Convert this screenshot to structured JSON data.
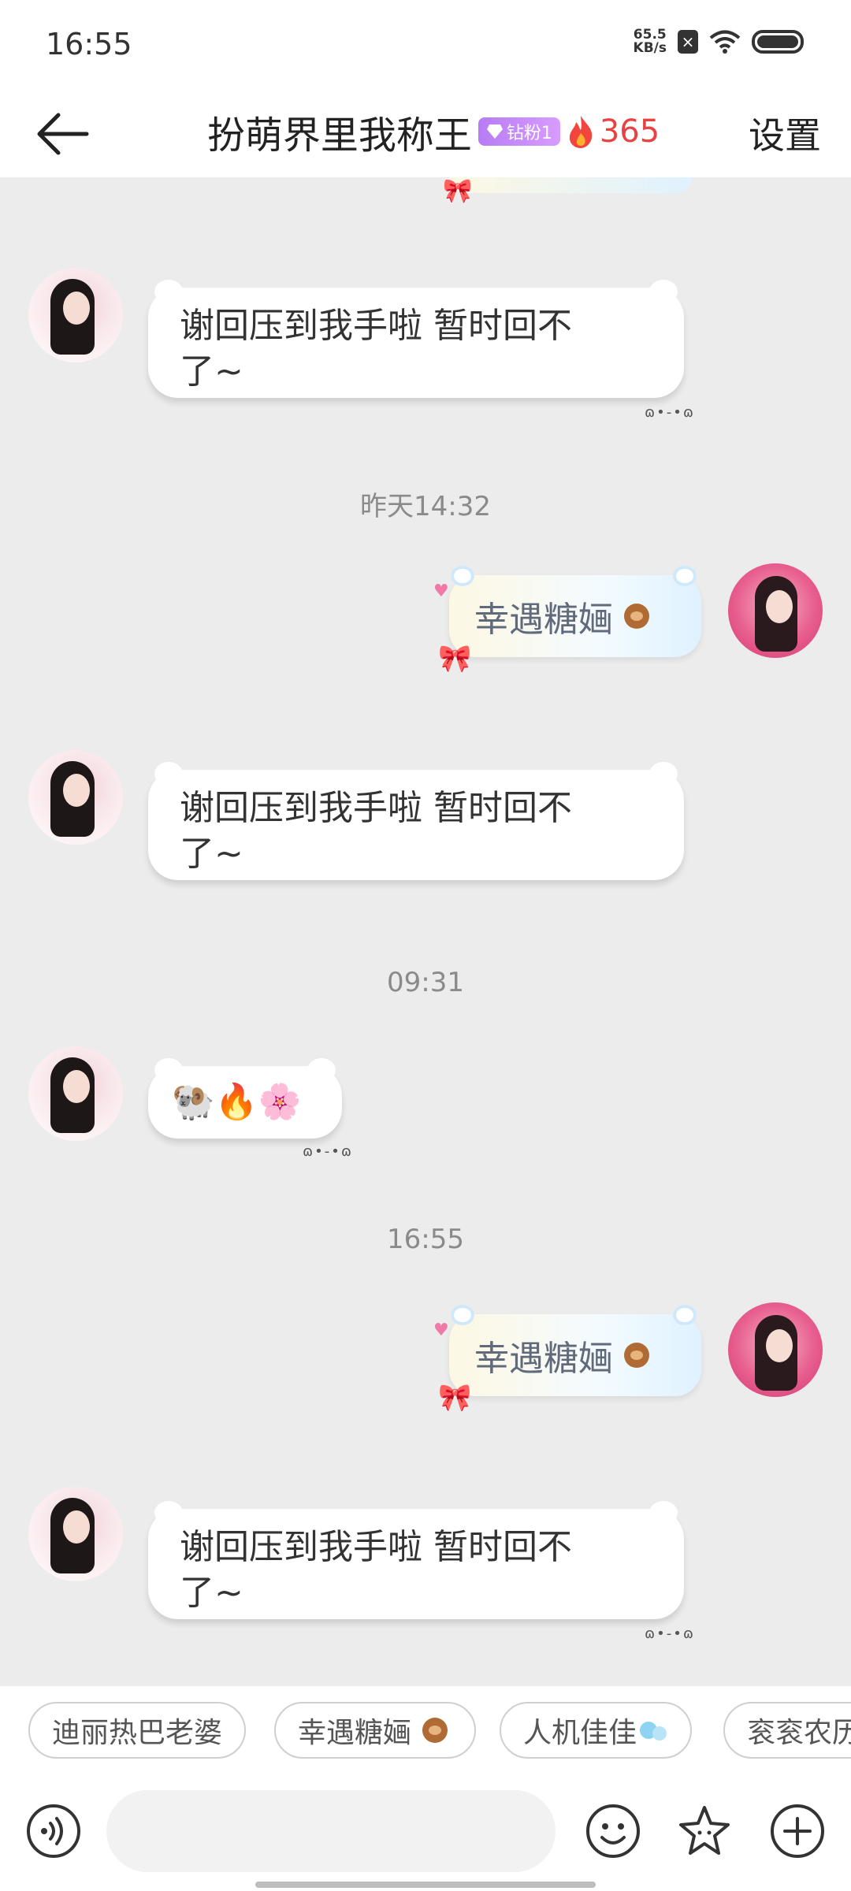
{
  "status_bar": {
    "time": "16:55",
    "net_speed_value": "65.5",
    "net_speed_unit": "KB/s"
  },
  "header": {
    "title": "扮萌界里我称王",
    "fan_badge": "钻粉1",
    "flame_count": "365",
    "settings_label": "设置"
  },
  "messages": [
    {
      "side": "left",
      "text_line1": "谢回压到我手啦 暂时回不",
      "text_line2": "了~"
    },
    {
      "type": "timestamp",
      "text": "昨天14:32"
    },
    {
      "side": "right",
      "text": "幸遇糖婳"
    },
    {
      "side": "left",
      "text_line1": "谢回压到我手啦 暂时回不",
      "text_line2": "了~"
    },
    {
      "type": "timestamp",
      "text": "09:31"
    },
    {
      "side": "left",
      "text": "🐏🔥🌸"
    },
    {
      "type": "timestamp",
      "text": "16:55"
    },
    {
      "side": "right",
      "text": "幸遇糖婳"
    },
    {
      "side": "left",
      "text_line1": "谢回压到我手啦 暂时回不",
      "text_line2": "了~"
    }
  ],
  "quick_replies": [
    "迪丽热巴老婆",
    "幸遇糖婳",
    "人机佳佳",
    "衮衮农历"
  ],
  "input": {
    "placeholder": ""
  },
  "icons": {
    "back": "arrow-left-icon",
    "voice": "voice-icon",
    "emoji": "smiley-icon",
    "sticker": "star-icon",
    "more": "plus-icon"
  }
}
